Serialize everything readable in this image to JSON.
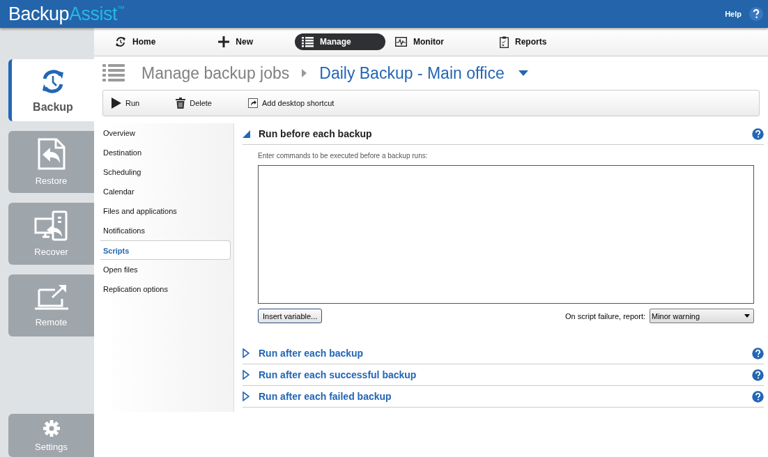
{
  "app": {
    "logo_primary": "Backup",
    "logo_secondary": "Assist",
    "logo_mark": "™",
    "help": "Help"
  },
  "rail": [
    {
      "label": "Backup",
      "selected": true
    },
    {
      "label": "Restore",
      "selected": false
    },
    {
      "label": "Recover",
      "selected": false
    },
    {
      "label": "Remote",
      "selected": false
    }
  ],
  "rail_bottom": {
    "label": "Settings"
  },
  "nav": [
    {
      "label": "Home",
      "selected": false
    },
    {
      "label": "New",
      "selected": false
    },
    {
      "label": "Manage",
      "selected": true
    },
    {
      "label": "Monitor",
      "selected": false
    },
    {
      "label": "Reports",
      "selected": false
    }
  ],
  "breadcrumb": {
    "parent": "Manage backup jobs",
    "current": "Daily Backup - Main office"
  },
  "toolbar": [
    {
      "label": "Run"
    },
    {
      "label": "Delete"
    },
    {
      "label": "Add desktop shortcut"
    }
  ],
  "menu": [
    {
      "label": "Overview",
      "selected": false
    },
    {
      "label": "Destination",
      "selected": false
    },
    {
      "label": "Scheduling",
      "selected": false
    },
    {
      "label": "Calendar",
      "selected": false
    },
    {
      "label": "Files and applications",
      "selected": false
    },
    {
      "label": "Notifications",
      "selected": false
    },
    {
      "label": "Scripts",
      "selected": true
    },
    {
      "label": "Open files",
      "selected": false
    },
    {
      "label": "Replication options",
      "selected": false
    }
  ],
  "sections": [
    {
      "title": "Run before each backup",
      "expanded": true,
      "hint": "Enter commands to be executed before a backup runs:",
      "button": "Insert variable...",
      "report_label": "On script failure, report:",
      "report_value": "Minor warning"
    },
    {
      "title": "Run after each backup",
      "expanded": false
    },
    {
      "title": "Run after each successful backup",
      "expanded": false
    },
    {
      "title": "Run after each failed backup",
      "expanded": false
    }
  ]
}
